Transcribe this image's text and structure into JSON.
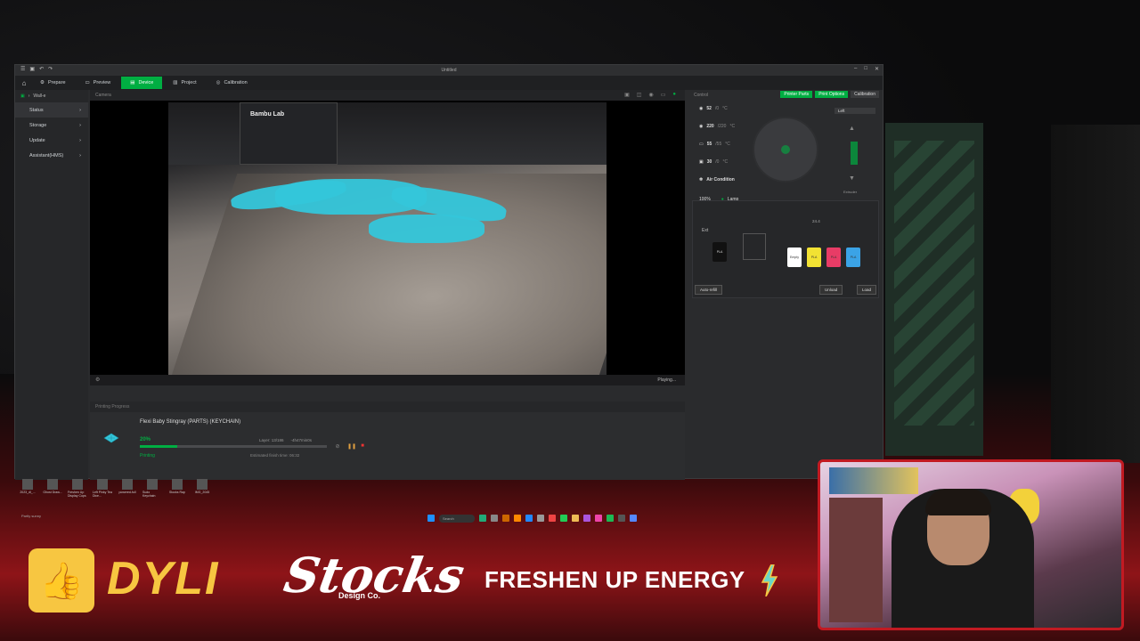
{
  "app": {
    "title": "Untitled",
    "tabs": [
      {
        "label": "Prepare"
      },
      {
        "label": "Preview"
      },
      {
        "label": "Device"
      },
      {
        "label": "Project"
      },
      {
        "label": "Calibration"
      }
    ],
    "sidebar": {
      "device": "Wall-e",
      "items": [
        {
          "label": "Status"
        },
        {
          "label": "Storage"
        },
        {
          "label": "Update"
        },
        {
          "label": "Assistant(HMS)"
        }
      ]
    },
    "camera": {
      "header": "Camera",
      "brand": "Bambu Lab",
      "status": "Playing..."
    },
    "progress": {
      "header": "Printing Progress",
      "job_name": "Flexi Baby Stingray (PARTS) (KEYCHAIN)",
      "percent_text": "20%",
      "percent_value": 0.2,
      "layer": "Layer: 13/186",
      "remaining": "-4h47min0s",
      "state": "Printing",
      "finish_time": "Estimated finish time: 06:32"
    },
    "control": {
      "header": "Control",
      "buttons": [
        "Printer Parts",
        "Print Options",
        "Calibration"
      ],
      "temps": [
        {
          "value": "52",
          "target": "/0",
          "unit": "°C"
        },
        {
          "value": "220",
          "target": "/220",
          "unit": "°C"
        },
        {
          "value": "55",
          "target": "/55",
          "unit": "°C"
        },
        {
          "value": "30",
          "target": "/0",
          "unit": "°C"
        }
      ],
      "air_condition": "Air Condition",
      "fan": "100%",
      "lamp": "Lamp",
      "extruder_tab": "Left",
      "extruder_label": "Extruder",
      "ams": {
        "ext_label": "Ext",
        "ext_spool": "PLA",
        "humidity": "24.4",
        "spools": [
          {
            "label": "Empty",
            "color": "#ffffff"
          },
          {
            "label": "PLA",
            "color": "#f2e233"
          },
          {
            "label": "PLA",
            "color": "#e83c66"
          },
          {
            "label": "PLA",
            "color": "#3ba3e6"
          }
        ],
        "auto_refill": "Auto-refill",
        "unload": "Unload",
        "load": "Load"
      }
    }
  },
  "desktop": {
    "icons": [
      "2023_dl_...",
      "Ghost Draw...",
      "Freshen Up Display Cups",
      "Left Pinky Tea Dice...",
      "powered-full",
      "Sudo Keychain",
      "Stocks Rap",
      "IMG_2045"
    ],
    "search": "Search",
    "tray_status": "Partly sunny"
  },
  "overlay": {
    "brand1": "DYLI",
    "brand2": "Stocks",
    "brand2_sub": "Design Co.",
    "brand3": "FRESHEN UP ENERGY"
  }
}
